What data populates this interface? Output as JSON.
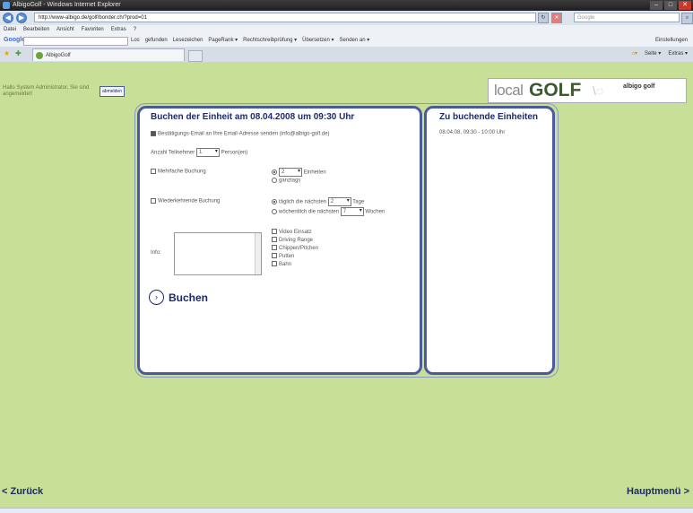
{
  "window": {
    "title": "AlbigoGolf - Windows Internet Explorer",
    "min": "–",
    "max": "□",
    "close": "✕"
  },
  "address": {
    "url": "http://www-albigo.de/golf/bonder.ch/?prod=01",
    "search_placeholder": "Google"
  },
  "menubar": [
    "Datei",
    "Bearbeiten",
    "Ansicht",
    "Favoriten",
    "Extras",
    "?"
  ],
  "toolbar": {
    "google_label": "Google G▾",
    "items": [
      "Los",
      "gefunden",
      "Lesezeichen",
      "PageRank ▾",
      "Rechtschreibprüfung ▾",
      "Übersetzen ▾",
      "Senden an ▾"
    ],
    "right": "Einstellungen"
  },
  "tab": {
    "title": "AlbigoGolf"
  },
  "commandbar": [
    "Startseite ▾",
    "Seite ▾",
    "Extras ▾"
  ],
  "page": {
    "user_info": "Hallo System Administrator, Sie sind angemeldet!",
    "logout": "abmelden",
    "logo": {
      "local": "local",
      "golf": "GOLF",
      "partner": "albigo golf"
    },
    "booking": {
      "title": "Buchen der Einheit am 08.04.2008 um 09:30 Uhr",
      "confirm_email": "Bestätigungs-Email an Ihre Email-Adresse senden (info@albigo-golf.de)",
      "participants_label": "Anzahl Teilnehmer",
      "participants_value": "1",
      "participants_suffix": "Person(en)",
      "multi_label": "Mehrfache Buchung",
      "units_value": "2",
      "units_label": "Einheiten",
      "allday_label": "ganztags",
      "recurring_label": "Wiederkehrende Buchung",
      "daily_label": "täglich die nächsten",
      "daily_value": "2",
      "daily_suffix": "Tage",
      "weekly_label": "wöchentlich die nächsten",
      "weekly_value": "7",
      "weekly_suffix": "Wochen",
      "info_label": "Info:",
      "options": [
        "Video Einsatz",
        "Driving Range",
        "Chippen/Pitchen",
        "Putten",
        "Bahn"
      ],
      "submit": "Buchen"
    },
    "side": {
      "title": "Zu buchende Einheiten",
      "entry": "08.04.08, 09:30 - 10:00 Uhr"
    },
    "back": "< Zurück",
    "home": "Hauptmenü >"
  }
}
